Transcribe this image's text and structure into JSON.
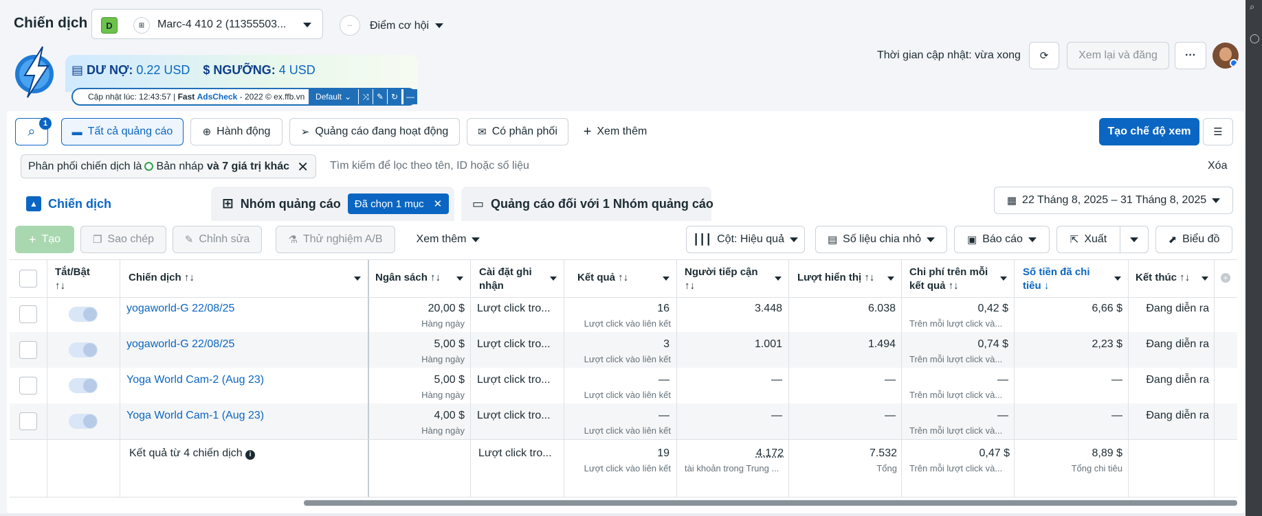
{
  "header": {
    "title": "Chiến dịch",
    "account_badge": "D",
    "account_icon": "⊞",
    "account_name": "Marc-4 410 2 (11355503...",
    "opportunity_score": "--",
    "opportunity_label": "Điểm cơ hội",
    "update_time": "Thời gian cập nhật: vừa xong",
    "review_publish": "Xem lại và đăng",
    "more": "···"
  },
  "fastads": {
    "debt_label": "DƯ NỢ:",
    "debt_value": "0.22 USD",
    "threshold_label": "NGƯỠNG:",
    "threshold_value": "4 USD",
    "updated_prefix": "Cập nhật lúc: 12:43:57 |",
    "brand_fast": "Fast",
    "brand_ads": "AdsCheck",
    "updated_suffix": "- 2022 © ex.ffb.vn",
    "default_label": "Default"
  },
  "toolbar": {
    "search_badge": "1",
    "all_ads": "Tất cả quảng cáo",
    "actions": "Hành động",
    "active_ads": "Quảng cáo đang hoạt động",
    "has_delivery": "Có phân phối",
    "see_more": "Xem thêm",
    "create_view": "Tạo chế độ xem"
  },
  "filter": {
    "chip_prefix": "Phân phối chiến dịch là",
    "chip_value": "Bản nháp",
    "chip_extra": "và 7 giá trị khác",
    "placeholder": "Tìm kiếm để lọc theo tên, ID hoặc số liệu",
    "clear": "Xóa"
  },
  "tabs": {
    "campaigns": "Chiến dịch",
    "ad_sets": "Nhóm quảng cáo",
    "ad_sets_chip": "Đã chọn 1 mục",
    "ads": "Quảng cáo đối với 1 Nhóm quảng cáo",
    "date_range": "22 Tháng 8, 2025 – 31 Tháng 8, 2025"
  },
  "actions": {
    "create": "Tạo",
    "copy": "Sao chép",
    "edit": "Chỉnh sửa",
    "ab_test": "Thử nghiệm A/B",
    "see_more": "Xem thêm",
    "columns": "Cột: Hiệu quả",
    "breakdown": "Số liệu chia nhỏ",
    "reports": "Báo cáo",
    "export": "Xuất",
    "chart": "Biểu đồ"
  },
  "table": {
    "headers": {
      "toggle_1": "Tắt/Bật",
      "toggle_2": "↑↓",
      "campaign": "Chiến dịch ↑↓",
      "budget": "Ngân sách ↑↓",
      "attribution_1": "Cài đặt ghi",
      "attribution_2": "nhận",
      "results": "Kết quả ↑↓",
      "reach_1": "Người tiếp cận",
      "reach_2": "↑↓",
      "impressions": "Lượt hiển thị ↑↓",
      "cpr_1": "Chi phí trên mỗi",
      "cpr_2": "kết quả ↑↓",
      "spent_1": "Số tiền đã chi",
      "spent_2": "tiêu ↓",
      "ends": "Kết thúc ↑↓"
    },
    "rows": [
      {
        "name": "yogaworld-G 22/08/25",
        "budget": "20,00 $",
        "budget_sub": "Hàng ngày",
        "attribution": "Lượt click tro...",
        "results": "16",
        "results_sub": "Lượt click vào liên kết",
        "reach": "3.448",
        "impressions": "6.038",
        "cpr": "0,42 $",
        "cpr_sub": "Trên mỗi lượt click và...",
        "spent": "6,66 $",
        "ends": "Đang diễn ra"
      },
      {
        "name": "yogaworld-G 22/08/25",
        "budget": "5,00 $",
        "budget_sub": "Hàng ngày",
        "attribution": "Lượt click tro...",
        "results": "3",
        "results_sub": "Lượt click vào liên kết",
        "reach": "1.001",
        "impressions": "1.494",
        "cpr": "0,74 $",
        "cpr_sub": "Trên mỗi lượt click và...",
        "spent": "2,23 $",
        "ends": "Đang diễn ra"
      },
      {
        "name": "Yoga World Cam-2 (Aug 23)",
        "budget": "5,00 $",
        "budget_sub": "Hàng ngày",
        "attribution": "Lượt click tro...",
        "results": "—",
        "results_sub": "Lượt click vào liên kết",
        "reach": "—",
        "impressions": "—",
        "cpr": "—",
        "cpr_sub": "Trên mỗi lượt click và...",
        "spent": "—",
        "ends": "Đang diễn ra"
      },
      {
        "name": "Yoga World Cam-1 (Aug 23)",
        "budget": "4,00 $",
        "budget_sub": "Hàng ngày",
        "attribution": "Lượt click tro...",
        "results": "—",
        "results_sub": "Lượt click vào liên kết",
        "reach": "—",
        "impressions": "—",
        "cpr": "—",
        "cpr_sub": "Trên mỗi lượt click và...",
        "spent": "—",
        "ends": "Đang diễn ra"
      }
    ],
    "summary": {
      "label": "Kết quả từ 4 chiến dịch",
      "attribution": "Lượt click tro...",
      "results": "19",
      "results_sub": "Lượt click vào liên kết",
      "reach": "4.172",
      "reach_sub": "tài khoản trong Trung ...",
      "impressions": "7.532",
      "impressions_sub": "Tổng",
      "cpr": "0,47 $",
      "cpr_sub": "Trên mỗi lượt click và...",
      "spent": "8,89 $",
      "spent_sub": "Tổng chi tiêu"
    }
  },
  "colors": {
    "accent": "#0a66c2",
    "top_bar": "#d6001c"
  }
}
